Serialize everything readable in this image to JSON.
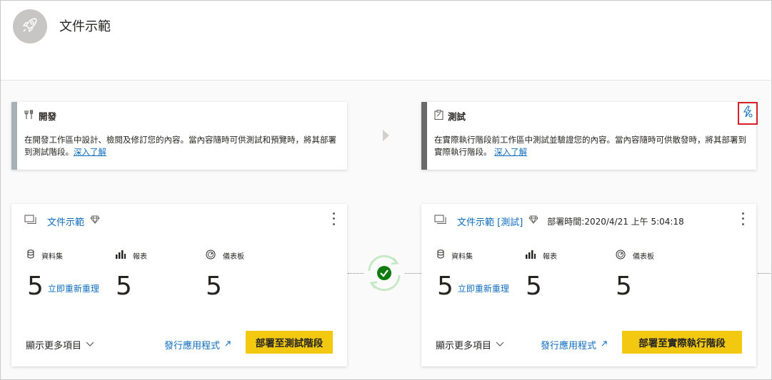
{
  "header": {
    "title": "文件示範",
    "avatar_icon": "rocket-icon"
  },
  "stages": {
    "dev": {
      "icon": "tools-icon",
      "title": "開發",
      "description": "在開發工作區中設計、檢閱及修訂您的內容。當內容隨時可供測試和預覽時，將其部署到測試階段。",
      "learn_more": "深入了解"
    },
    "test": {
      "icon": "clipboard-icon",
      "title": "測試",
      "description": "在實際執行階段前工作區中測試並驗證您的內容。當內容隨時可供散發時，將其部署到實際執行階段。",
      "learn_more": "深入了解",
      "pin_icon": "lightning-settings-icon"
    }
  },
  "workspaces": {
    "dev": {
      "name": "文件示範",
      "premium_icon": "diamond-icon",
      "metrics": {
        "datasets": {
          "label": "資料集",
          "value": "5",
          "link": "立即重新重理"
        },
        "reports": {
          "label": "報表",
          "value": "5"
        },
        "dashboards": {
          "label": "儀表板",
          "value": "5"
        }
      },
      "show_more": "顯示更多項目",
      "publish_app": "發行應用程式",
      "deploy_button": "部署至測試階段"
    },
    "test": {
      "name": "文件示範 [測試]",
      "premium_icon": "diamond-icon",
      "deploy_time": "部署時間:2020/4/21 上午 5:04:18",
      "metrics": {
        "datasets": {
          "label": "資料集",
          "value": "5",
          "link": "立即重新重理"
        },
        "reports": {
          "label": "報表",
          "value": "5"
        },
        "dashboards": {
          "label": "儀表板",
          "value": "5"
        }
      },
      "show_more": "顯示更多項目",
      "publish_app": "發行應用程式",
      "deploy_button": "部署至實際執行階段"
    }
  },
  "colors": {
    "accent_link": "#0f6cbd",
    "deploy_button": "#f2c811",
    "sync_green": "#107c10",
    "pin_border": "#d71f2a"
  }
}
